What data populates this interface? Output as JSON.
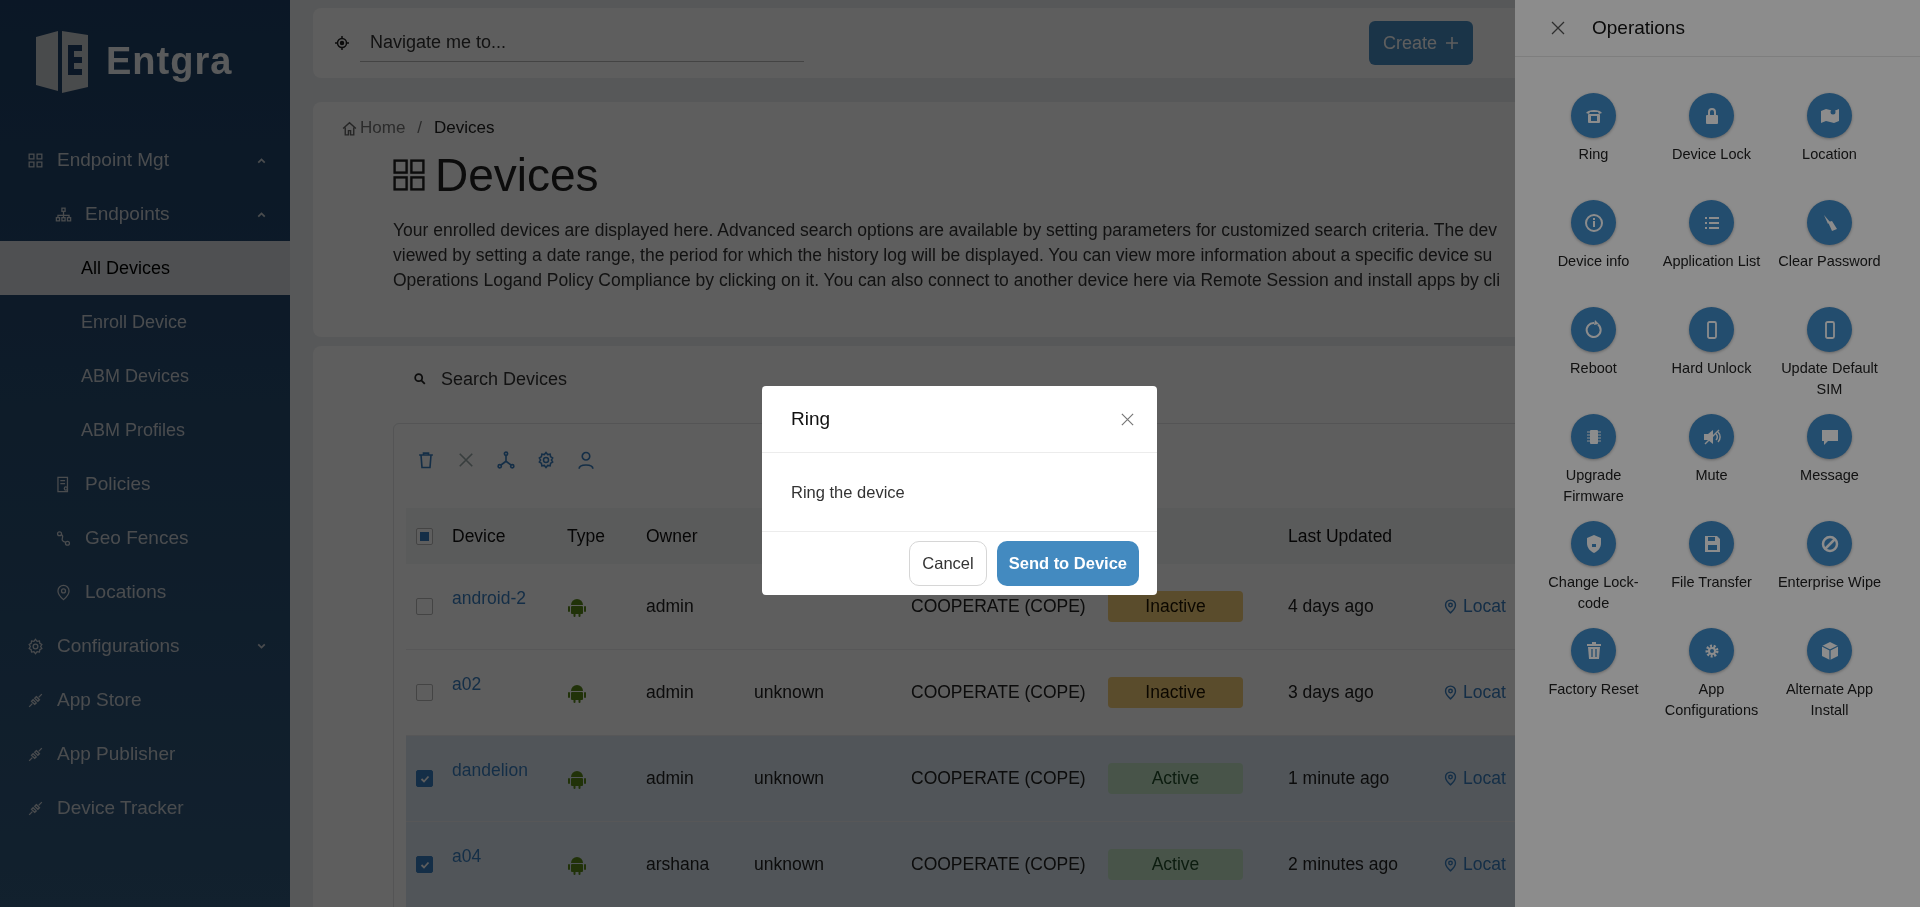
{
  "sidebar": {
    "logo": "Entgra",
    "items": [
      {
        "label": "Endpoint Mgt",
        "expanded": true,
        "selected": false,
        "children": [
          {
            "label": "Endpoints",
            "expanded": true,
            "selected": false,
            "children": [
              {
                "label": "All Devices",
                "selected": true
              },
              {
                "label": "Enroll Device",
                "selected": false
              },
              {
                "label": "ABM Devices",
                "selected": false
              },
              {
                "label": "ABM Profiles",
                "selected": false
              }
            ]
          },
          {
            "label": "Policies",
            "selected": false
          },
          {
            "label": "Geo Fences",
            "selected": false
          },
          {
            "label": "Locations",
            "selected": false
          }
        ]
      },
      {
        "label": "Configurations",
        "expanded": false,
        "selected": false
      },
      {
        "label": "App Store",
        "selected": false
      },
      {
        "label": "App Publisher",
        "selected": false
      },
      {
        "label": "Device Tracker",
        "selected": false
      }
    ]
  },
  "top_bar": {
    "navigate_placeholder": "Navigate me to...",
    "create_button": "Create"
  },
  "header": {
    "breadcrumb": [
      "Home",
      "/",
      "Devices"
    ],
    "title": "Devices",
    "description_lines": [
      "Your enrolled devices are displayed here. Advanced search options are available by setting parameters for customized search criteria. The dev",
      "viewed by setting a date range, the period for which the history log will be displayed. You can view more information about a specific device su",
      "Operations Logand Policy Compliance by clicking on it. You can also connect to another device here via Remote Session and install apps by cli"
    ]
  },
  "search": {
    "placeholder": "Search Devices"
  },
  "table": {
    "select_all_indeterminate": true,
    "headers": {
      "device": "Device",
      "type": "Type",
      "owner": "Owner",
      "last_updated": "Last Updated"
    },
    "rows": [
      {
        "selected": false,
        "device": "android-2",
        "owner": "admin",
        "column_5": "COOPERATE (COPE)",
        "status": {
          "label": "Inactive",
          "kind": "inactive"
        },
        "last_updated": "4 days ago",
        "column_8": "Locat"
      },
      {
        "selected": false,
        "device": "a02",
        "owner": "admin",
        "column_4": "unknown",
        "column_5": "COOPERATE (COPE)",
        "status": {
          "label": "Inactive",
          "kind": "inactive"
        },
        "last_updated": "3 days ago",
        "column_8": "Locat"
      },
      {
        "selected": true,
        "device": "dandelion",
        "owner": "admin",
        "column_4": "unknown",
        "column_5": "COOPERATE (COPE)",
        "status": {
          "label": "Active",
          "kind": "active"
        },
        "last_updated": "1 minute ago",
        "column_8": "Locat"
      },
      {
        "selected": true,
        "device": "a04",
        "owner": "arshana",
        "column_4": "unknown",
        "column_5": "COOPERATE (COPE)",
        "status": {
          "label": "Active",
          "kind": "active"
        },
        "last_updated": "2 minutes ago",
        "column_8": "Locat"
      }
    ]
  },
  "operations": {
    "title": "Operations",
    "items": [
      "Ring",
      "Device Lock",
      "Location",
      "Device info",
      "Application List",
      "Clear Password",
      "Reboot",
      "Hard Unlock",
      "Update Default SIM",
      "Upgrade Firmware",
      "Mute",
      "Message",
      "Change Lock-code",
      "File Transfer",
      "Enterprise Wipe",
      "Factory Reset",
      "App Configurations",
      "Alternate App Install"
    ]
  },
  "modal": {
    "title": "Ring",
    "body": "Ring the device",
    "buttons": [
      "Cancel",
      "Send to Device"
    ]
  }
}
